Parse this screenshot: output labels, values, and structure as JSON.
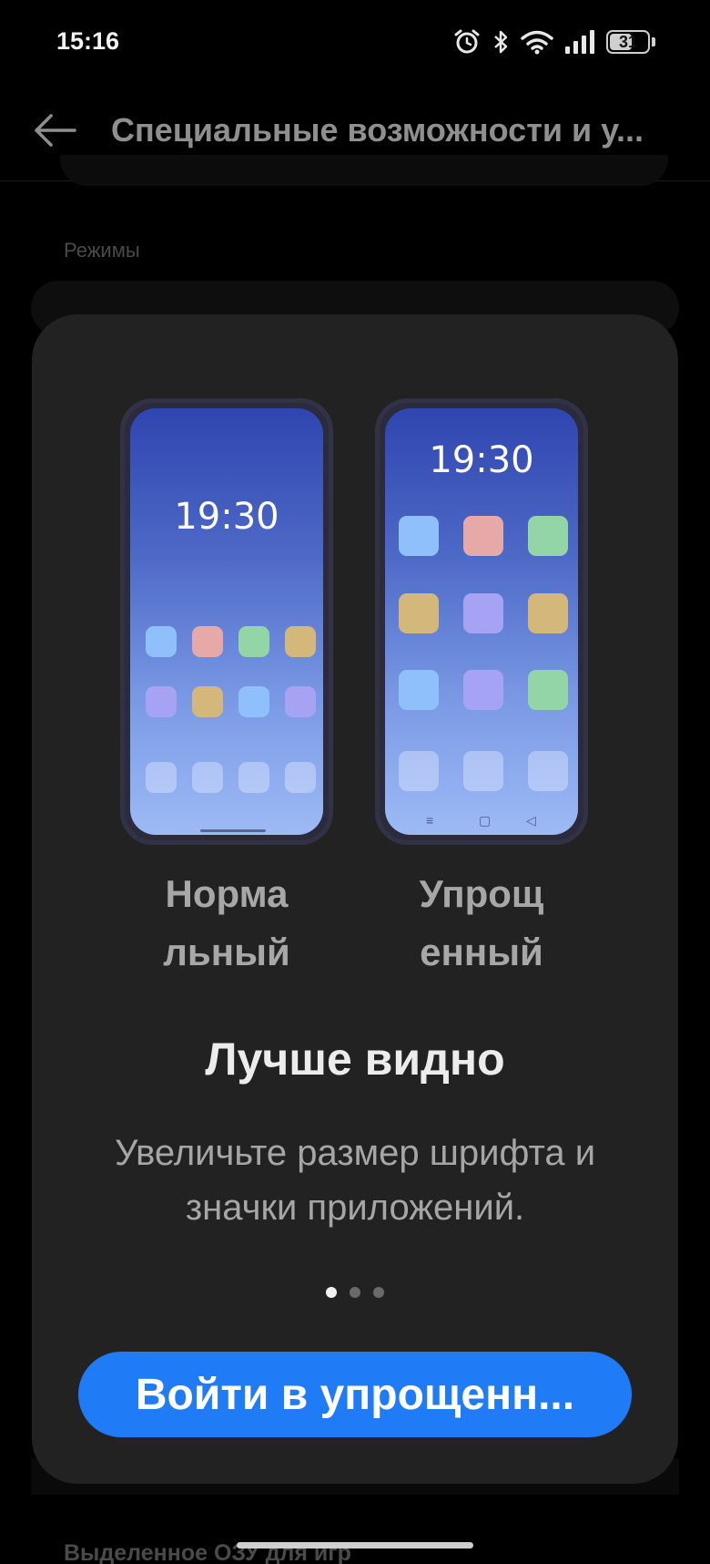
{
  "status_bar": {
    "time": "15:16",
    "battery": "31",
    "icons": [
      "alarm-icon",
      "bluetooth-icon",
      "wifi-icon",
      "signal-icon",
      "battery-icon"
    ]
  },
  "header": {
    "title": "Специальные возможности и у...",
    "back_icon": "arrow-left-icon"
  },
  "background": {
    "section_label": "Режимы",
    "section_label_2": "Выделенное ОЗУ для игр"
  },
  "sheet": {
    "modes": [
      {
        "label": "Норма\nльный",
        "clock": "19:30"
      },
      {
        "label": "Упрощ\nенный",
        "clock": "19:30"
      }
    ],
    "heading": "Лучше видно",
    "description": "Увеличьте размер шрифта и значки приложений.",
    "page_count": 3,
    "active_page": 0,
    "primary_button": "Войти в упрощенн..."
  },
  "colors": {
    "accent": "#1f7cf6",
    "sheet_bg": "#222222",
    "icon_blue": "#8fc0fb",
    "icon_pink": "#e7a9a8",
    "icon_green": "#93d5a6",
    "icon_gold": "#d4b77a",
    "icon_lavender": "#a7a3f4"
  }
}
